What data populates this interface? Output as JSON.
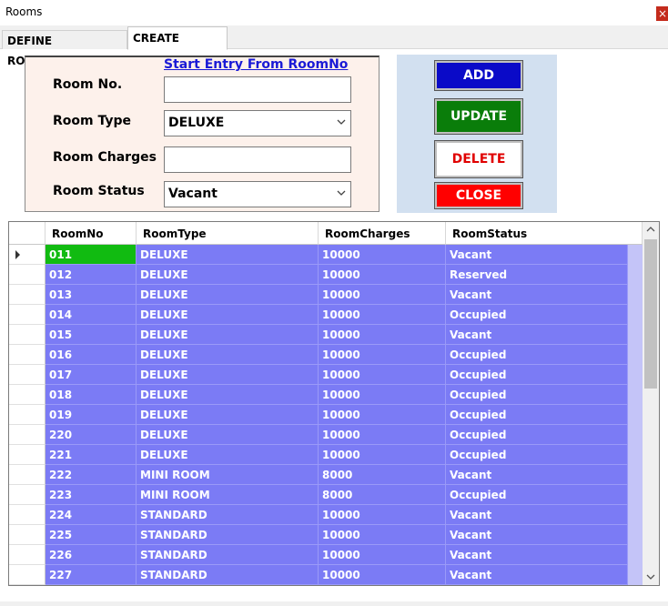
{
  "window": {
    "title": "Rooms",
    "close_glyph": "×"
  },
  "tabs": [
    {
      "label": "DEFINE ROOMTYPES",
      "active": false
    },
    {
      "label": "CREATE ROOMS",
      "active": true
    }
  ],
  "form": {
    "start_entry_link": "Start Entry From RoomNo",
    "room_no_label": "Room No.",
    "room_no_value": "",
    "room_type_label": "Room Type",
    "room_type_value": "DELUXE",
    "room_charges_label": "Room Charges",
    "room_charges_value": "",
    "room_status_label": "Room Status",
    "room_status_value": "Vacant"
  },
  "buttons": {
    "add": "ADD",
    "update": "UPDATE",
    "delete": "DELETE",
    "close": "CLOSE"
  },
  "grid": {
    "columns": [
      "RoomNo",
      "RoomType",
      "RoomCharges",
      "RoomStatus"
    ],
    "selected_index": 0,
    "rows": [
      [
        "011",
        "DELUXE",
        "10000",
        "Vacant"
      ],
      [
        "012",
        "DELUXE",
        "10000",
        "Reserved"
      ],
      [
        "013",
        "DELUXE",
        "10000",
        "Vacant"
      ],
      [
        "014",
        "DELUXE",
        "10000",
        "Occupied"
      ],
      [
        "015",
        "DELUXE",
        "10000",
        "Vacant"
      ],
      [
        "016",
        "DELUXE",
        "10000",
        "Occupied"
      ],
      [
        "017",
        "DELUXE",
        "10000",
        "Occupied"
      ],
      [
        "018",
        "DELUXE",
        "10000",
        "Occupied"
      ],
      [
        "019",
        "DELUXE",
        "10000",
        "Occupied"
      ],
      [
        "220",
        "DELUXE",
        "10000",
        "Occupied"
      ],
      [
        "221",
        "DELUXE",
        "10000",
        "Occupied"
      ],
      [
        "222",
        "MINI ROOM",
        "8000",
        "Vacant"
      ],
      [
        "223",
        "MINI ROOM",
        "8000",
        "Occupied"
      ],
      [
        "224",
        "STANDARD",
        "10000",
        "Vacant"
      ],
      [
        "225",
        "STANDARD",
        "10000",
        "Vacant"
      ],
      [
        "226",
        "STANDARD",
        "10000",
        "Vacant"
      ],
      [
        "227",
        "STANDARD",
        "10000",
        "Vacant"
      ]
    ]
  },
  "icons": {
    "select_chevron": "chevron-down-icon",
    "row_indicator": "row-pointer-icon",
    "scroll_up": "scroll-up-icon",
    "scroll_down": "scroll-down-icon"
  },
  "colors": {
    "grid_cell": "#7b7bf5",
    "selected_cell": "#11bb11",
    "add_button": "#0a0ac8",
    "update_button": "#0a7d0a",
    "delete_text": "#e00000",
    "close_button": "#ff0000",
    "link": "#1a1ad6"
  }
}
